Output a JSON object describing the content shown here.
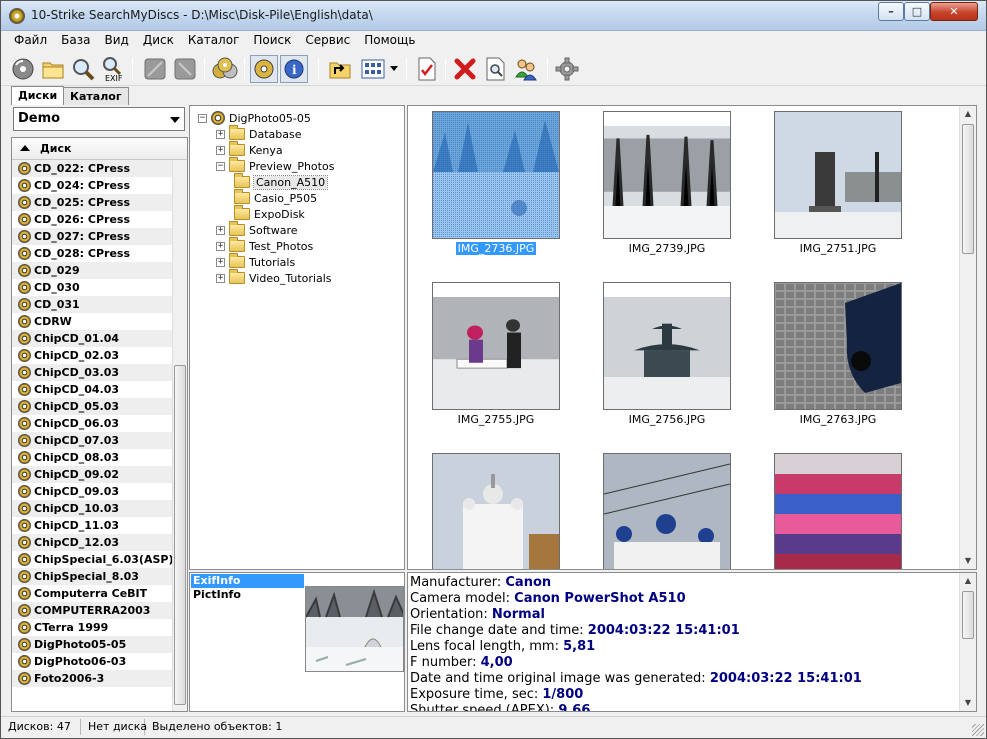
{
  "window": {
    "title": "10-Strike SearchMyDiscs - D:\\Misc\\Disk-Pile\\English\\data\\",
    "minimize_glyph": "–",
    "maximize_glyph": "□",
    "close_glyph": "✕"
  },
  "menu": [
    "Файл",
    "База",
    "Вид",
    "Диск",
    "Каталог",
    "Поиск",
    "Сервис",
    "Помощь"
  ],
  "toolbar": {
    "exif_label": "EXIF"
  },
  "tabs": [
    "Диски",
    "Каталог"
  ],
  "left": {
    "database_selected": "Demo",
    "list_header": "Диск",
    "disks": [
      "CD_022: CPress",
      "CD_024: CPress",
      "CD_025: CPress",
      "CD_026: CPress",
      "CD_027: CPress",
      "CD_028: CPress",
      "CD_029",
      "CD_030",
      "CD_031",
      "CDRW",
      "ChipCD_01.04",
      "ChipCD_02.03",
      "ChipCD_03.03",
      "ChipCD_04.03",
      "ChipCD_05.03",
      "ChipCD_06.03",
      "ChipCD_07.03",
      "ChipCD_08.03",
      "ChipCD_09.02",
      "ChipCD_09.03",
      "ChipCD_10.03",
      "ChipCD_11.03",
      "ChipCD_12.03",
      "ChipSpecial_6.03(ASP)",
      "ChipSpecial_8.03",
      "Computerra CeBIT",
      "COMPUTERRA2003",
      "CTerra 1999",
      "DigPhoto05-05",
      "DigPhoto06-03",
      "Foto2006-3"
    ]
  },
  "tree": {
    "root": "DigPhoto05-05",
    "items": [
      {
        "label": "Database",
        "level": 1,
        "expandable": true
      },
      {
        "label": "Kenya",
        "level": 1,
        "expandable": true
      },
      {
        "label": "Preview_Photos",
        "level": 1,
        "expandable": true,
        "expanded": true
      },
      {
        "label": "Canon_A510",
        "level": 2,
        "expandable": false,
        "selected": true
      },
      {
        "label": "Casio_P505",
        "level": 2,
        "expandable": false
      },
      {
        "label": "ExpoDisk",
        "level": 2,
        "expandable": false
      },
      {
        "label": "Software",
        "level": 1,
        "expandable": true
      },
      {
        "label": "Test_Photos",
        "level": 1,
        "expandable": true
      },
      {
        "label": "Tutorials",
        "level": 1,
        "expandable": true
      },
      {
        "label": "Video_Tutorials",
        "level": 1,
        "expandable": true
      }
    ]
  },
  "thumbnails": [
    {
      "name": "IMG_2736.JPG",
      "selected": true
    },
    {
      "name": "IMG_2739.JPG"
    },
    {
      "name": "IMG_2751.JPG"
    },
    {
      "name": "IMG_2755.JPG"
    },
    {
      "name": "IMG_2756.JPG"
    },
    {
      "name": "IMG_2763.JPG"
    },
    {
      "name": ""
    },
    {
      "name": ""
    },
    {
      "name": ""
    }
  ],
  "info_tabs": [
    "ExifInfo",
    "PictInfo"
  ],
  "exif": [
    {
      "label": "Manufacturer:",
      "value": "Canon"
    },
    {
      "label": "Camera model:",
      "value": "Canon PowerShot A510"
    },
    {
      "label": "Orientation:",
      "value": "Normal"
    },
    {
      "label": "File change date and time:",
      "value": "2004:03:22 15:41:01"
    },
    {
      "label": "Lens focal length, mm:",
      "value": "5,81"
    },
    {
      "label": "F number:",
      "value": "4,00"
    },
    {
      "label": "Date and time original image was generated:",
      "value": "2004:03:22 15:41:01"
    },
    {
      "label": "Exposure time, sec:",
      "value": "1/800"
    },
    {
      "label": "Shutter speed (APEX):",
      "value": "9,66"
    }
  ],
  "status": {
    "disks_count": "Дисков: 47",
    "no_disk": "Нет диска",
    "selected": "Выделено объектов: 1"
  },
  "colors": {
    "selection": "#3399ff",
    "exif_value": "#000080"
  }
}
